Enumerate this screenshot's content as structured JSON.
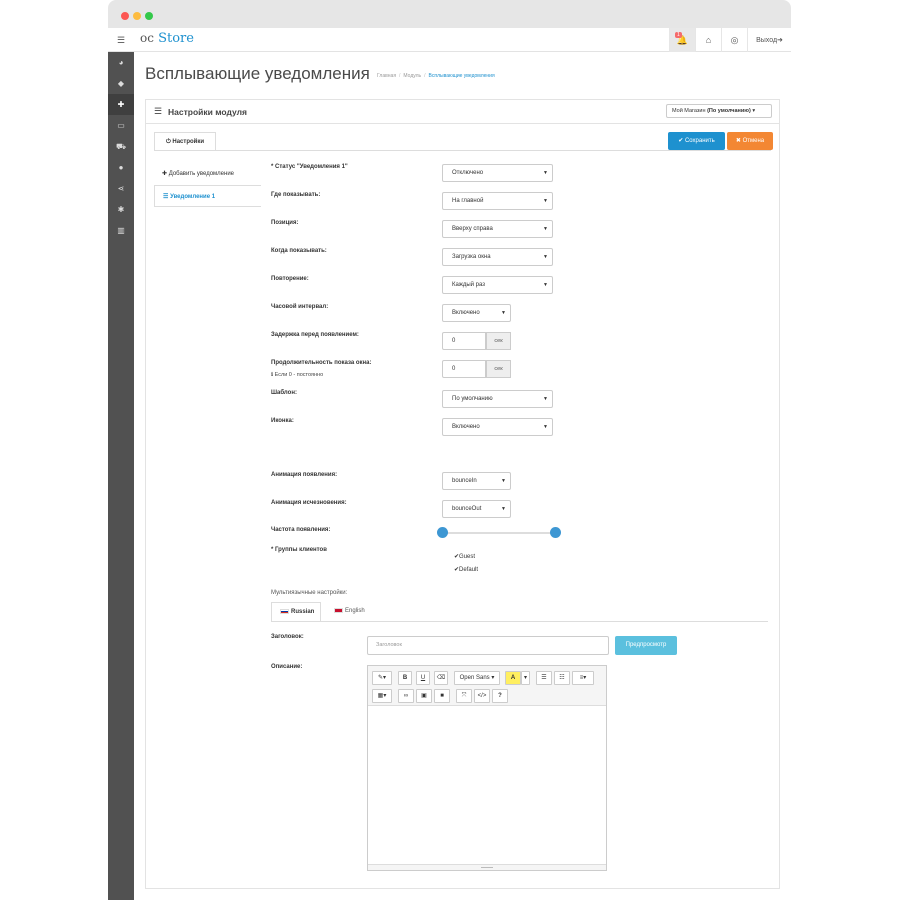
{
  "topbar": {
    "logo_prefix": "oc",
    "logo_main": "Store",
    "notification_count": "1",
    "logout_label": "Выход"
  },
  "page": {
    "title": "Всплывающие уведомления",
    "breadcrumb": [
      "Главная",
      "Модуль",
      "Всплывающие уведомления"
    ]
  },
  "panel": {
    "title": "Настройки модуля",
    "store_select_prefix": "Мой Магазин",
    "store_select_value": "(По умолчанию)",
    "tab_settings": "Настройки",
    "save_label": "Сохранить",
    "cancel_label": "Отмена"
  },
  "left_nav": {
    "add_label": "Добавить уведомление",
    "item_label": "Уведомление 1"
  },
  "form": {
    "status_label": "* Статус \"Уведомления 1\"",
    "status_value": "Отключено",
    "where_label": "Где показывать:",
    "where_value": "На главной",
    "position_label": "Позиция:",
    "position_value": "Вверху справа",
    "when_label": "Когда показывать:",
    "when_value": "Загрузка окна",
    "repeat_label": "Повторение:",
    "repeat_value": "Каждый раз",
    "hourly_label": "Часовой интервал:",
    "hourly_value": "Включено",
    "delay_label": "Задержка перед появлением:",
    "delay_value": "0",
    "delay_unit": "сек",
    "duration_label": "Продолжительность показа окна:",
    "duration_value": "0",
    "duration_unit": "сек",
    "duration_hint": "Если 0 - постоянно",
    "template_label": "Шаблон:",
    "template_value": "По умолчанию",
    "icon_label": "Иконка:",
    "icon_value": "Включено",
    "anim_in_label": "Анимация появления:",
    "anim_in_value": "bounceIn",
    "anim_out_label": "Анимация исчезновения:",
    "anim_out_value": "bounceOut",
    "freq_label": "Частота появления:",
    "freq_range": [
      0.0,
      1.0
    ],
    "groups_label": "* Группы клиентов",
    "groups": [
      "Guest",
      "Default"
    ]
  },
  "multilang": {
    "label": "Мультиязычные настройки:",
    "tab_ru": "Russian",
    "tab_en": "English",
    "heading_label": "Заголовок:",
    "heading_placeholder": "Заголовок",
    "preview_label": "Предпросмотр",
    "description_label": "Описание:",
    "font_name": "Open Sans"
  }
}
